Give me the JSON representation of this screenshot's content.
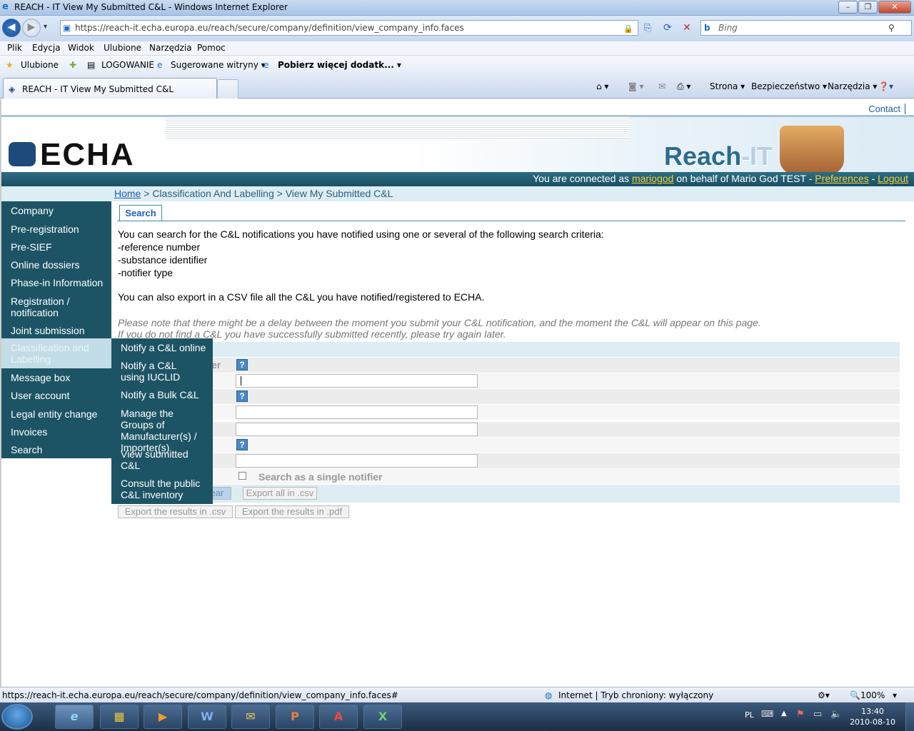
{
  "window": {
    "title": "REACH - IT View My Submitted C&L - Windows Internet Explorer"
  },
  "address": {
    "url": "https://reach-it.echa.europa.eu/reach/secure/company/definition/view_company_info.faces",
    "search_placeholder": "Bing"
  },
  "menu": [
    "Plik",
    "Edycja",
    "Widok",
    "Ulubione",
    "Narzędzia",
    "Pomoc"
  ],
  "favorites": {
    "label": "Ulubione",
    "items": [
      "LOGOWANIE",
      "Sugerowane witryny ▾",
      "Pobierz więcej dodatk... ▾"
    ]
  },
  "tab": {
    "title": "REACH - IT View My Submitted C&L"
  },
  "commandbar": {
    "page": "Strona ▾",
    "safety": "Bezpieczeństwo ▾",
    "tools": "Narzędzia ▾"
  },
  "site": {
    "contact": "Contact",
    "logo": "ECHA",
    "reachit_reach": "Reach",
    "reachit_it": "-IT",
    "user": {
      "prefix": "You are connected as ",
      "name": "mariogod",
      "middle": " on behalf of Mario God TEST - ",
      "preferences": "Preferences",
      "sep": " - ",
      "logout": "Logout"
    },
    "breadcrumb": {
      "home": "Home",
      "rest": " > Classification And Labelling > View My Submitted C&L"
    }
  },
  "sidebar": [
    "Company",
    "Pre-registration",
    "Pre-SIEF",
    "Online dossiers",
    "Phase-in Information",
    "Registration / notification",
    "Joint submission",
    "Classification and Labelling",
    "Message box",
    "User account",
    "Legal entity change",
    "Invoices",
    "Search"
  ],
  "flyout": [
    "Notify a C&L online",
    "Notify a C&L using IUCLID",
    "Notify a Bulk C&L",
    "Manage the Groups of Manufacturer(s) / Importer(s)",
    "View submitted C&L",
    "Consult the public C&L inventory"
  ],
  "content": {
    "tab": "Search",
    "intro": "You can search for the C&L notifications you have notified using one or several of the following search criteria:",
    "criteria": [
      "-reference number",
      "-substance identifier",
      "-notifier type"
    ],
    "export_info": "You can also export in a CSV file all the C&L you have notified/registered to ECHA.",
    "note1": "Please note that there might be a delay between the moment you submit your C&L notification, and the moment the C&L will appear on this page.",
    "note2": "If you do not find a C&L you have successfully submitted recently, please try again later.",
    "partial_label": "er",
    "checkbox_label": "Search as a single notifier",
    "clear_partial": "ear",
    "export_all": "Export all in .csv",
    "export_csv": "Export the results in .csv",
    "export_pdf": "Export the results in .pdf"
  },
  "status": {
    "url": "https://reach-it.echa.europa.eu/reach/secure/company/definition/view_company_info.faces#",
    "zone": "Internet | Tryb chroniony: wyłączony",
    "zoom": "100%"
  },
  "taskbar": {
    "lang": "PL",
    "time": "13:40",
    "date": "2010-08-10"
  }
}
